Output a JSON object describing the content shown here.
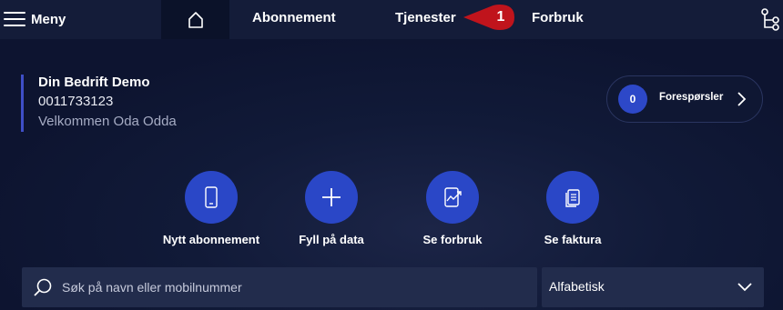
{
  "nav": {
    "menu_label": "Meny",
    "items": [
      {
        "label": "Abonnement"
      },
      {
        "label": "Tjenester"
      },
      {
        "label": "Forbruk"
      }
    ],
    "badge": {
      "number": "1",
      "color": "#c0141c"
    }
  },
  "company": {
    "name": "Din Bedrift Demo",
    "id": "0011733123",
    "welcome": "Velkommen Oda Odda"
  },
  "requests": {
    "count": "0",
    "label": "Forespørsler"
  },
  "actions": [
    {
      "label": "Nytt abonnement",
      "icon": "mobile-phone-icon"
    },
    {
      "label": "Fyll på data",
      "icon": "plus-icon"
    },
    {
      "label": "Se forbruk",
      "icon": "usage-chart-icon"
    },
    {
      "label": "Se faktura",
      "icon": "invoice-icon"
    }
  ],
  "search": {
    "placeholder": "Søk på navn eller mobilnummer"
  },
  "sort": {
    "selected": "Alfabetisk"
  },
  "colors": {
    "accent": "#2a47c7",
    "background": "#0d1430",
    "topbar": "#141c39",
    "badge": "#c0141c"
  }
}
